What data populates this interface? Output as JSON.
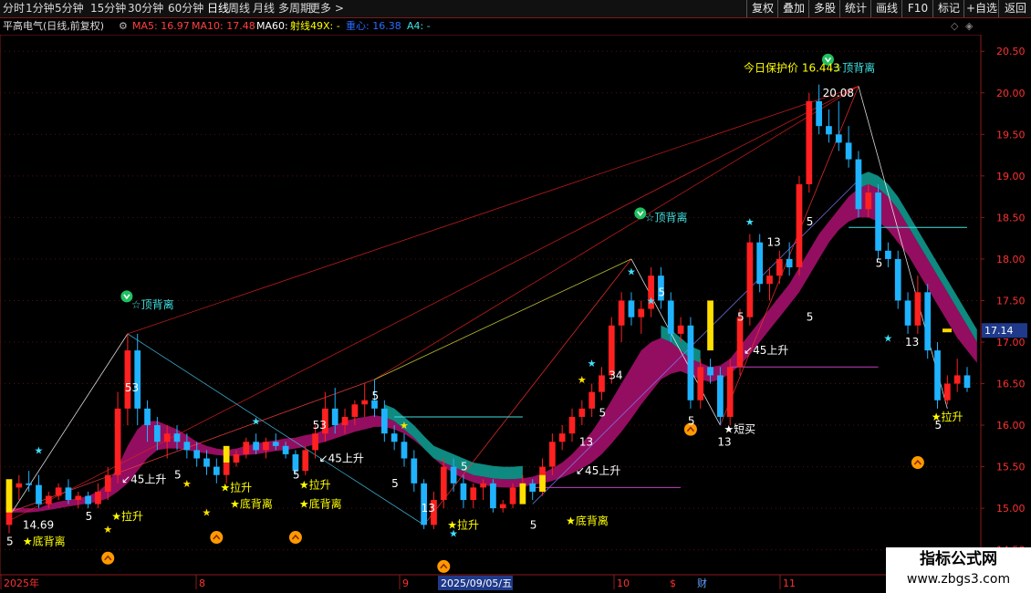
{
  "topbar": {
    "left_tabs": [
      "分时",
      "1分钟",
      "5分钟",
      "15分钟",
      "30分钟",
      "60分钟",
      "日线",
      "周线",
      "月线",
      "多周期",
      "更多 >"
    ],
    "active_tab": "日线",
    "right_buttons": [
      "复权",
      "叠加",
      "多股",
      "统计",
      "画线",
      "F10",
      "标记",
      "+自选",
      "返回"
    ]
  },
  "infobar": {
    "stock": "平高电气(日线,前复权)",
    "ma5": "MA5: 16.97",
    "ma10": "MA10: 17.48",
    "ma60": "MA60: ",
    "shexian": "射线49X: -",
    "zhongxin": "重心: 16.38",
    "a4": "A4: -",
    "colors": {
      "stock": "#cccccc",
      "ma5": "#ff4040",
      "ma10": "#ff4040",
      "ma60": "#ffffff",
      "shexian": "#ffff00",
      "zhongxin": "#2a6bff",
      "a4": "#40e0e0"
    }
  },
  "axis": {
    "y_ticks": [
      "20.50",
      "20.00",
      "19.50",
      "19.00",
      "18.50",
      "18.00",
      "17.50",
      "17.00",
      "16.50",
      "16.00",
      "15.50",
      "15.00",
      "14.50"
    ],
    "current_price": "17.14",
    "x_labels": [
      "2025年",
      "8",
      "9",
      "2025/09/05/五",
      "10",
      "11"
    ],
    "bottom_markers": [
      "$",
      "财"
    ]
  },
  "chart_data": {
    "type": "candlestick",
    "ylim": [
      14.2,
      20.7
    ],
    "candles": [
      {
        "o": 14.8,
        "h": 15.3,
        "l": 14.7,
        "c": 15.25
      },
      {
        "o": 15.25,
        "h": 15.4,
        "l": 15.1,
        "c": 15.3
      },
      {
        "o": 15.3,
        "h": 15.45,
        "l": 15.2,
        "c": 15.28
      },
      {
        "o": 15.28,
        "h": 15.4,
        "l": 15.0,
        "c": 15.05
      },
      {
        "o": 15.05,
        "h": 15.2,
        "l": 15.0,
        "c": 15.15
      },
      {
        "o": 15.15,
        "h": 15.3,
        "l": 15.1,
        "c": 15.25
      },
      {
        "o": 15.25,
        "h": 15.35,
        "l": 15.05,
        "c": 15.1
      },
      {
        "o": 15.1,
        "h": 15.2,
        "l": 15.0,
        "c": 15.15
      },
      {
        "o": 15.15,
        "h": 15.2,
        "l": 15.0,
        "c": 15.05
      },
      {
        "o": 15.05,
        "h": 15.3,
        "l": 15.0,
        "c": 15.2
      },
      {
        "o": 15.2,
        "h": 15.5,
        "l": 15.1,
        "c": 15.4
      },
      {
        "o": 15.4,
        "h": 16.4,
        "l": 15.3,
        "c": 16.2
      },
      {
        "o": 16.2,
        "h": 17.1,
        "l": 16.0,
        "c": 16.9
      },
      {
        "o": 16.9,
        "h": 17.1,
        "l": 16.0,
        "c": 16.2
      },
      {
        "o": 16.2,
        "h": 16.3,
        "l": 15.8,
        "c": 16.0
      },
      {
        "o": 16.0,
        "h": 16.1,
        "l": 15.7,
        "c": 15.8
      },
      {
        "o": 15.8,
        "h": 16.0,
        "l": 15.6,
        "c": 15.9
      },
      {
        "o": 15.9,
        "h": 16.0,
        "l": 15.7,
        "c": 15.8
      },
      {
        "o": 15.8,
        "h": 15.9,
        "l": 15.6,
        "c": 15.7
      },
      {
        "o": 15.7,
        "h": 15.8,
        "l": 15.5,
        "c": 15.6
      },
      {
        "o": 15.6,
        "h": 15.7,
        "l": 15.4,
        "c": 15.5
      },
      {
        "o": 15.5,
        "h": 15.6,
        "l": 15.3,
        "c": 15.4
      },
      {
        "o": 15.4,
        "h": 15.6,
        "l": 15.3,
        "c": 15.55
      },
      {
        "o": 15.55,
        "h": 15.7,
        "l": 15.5,
        "c": 15.65
      },
      {
        "o": 15.65,
        "h": 15.85,
        "l": 15.6,
        "c": 15.8
      },
      {
        "o": 15.8,
        "h": 15.9,
        "l": 15.65,
        "c": 15.7
      },
      {
        "o": 15.7,
        "h": 15.85,
        "l": 15.6,
        "c": 15.8
      },
      {
        "o": 15.8,
        "h": 15.9,
        "l": 15.7,
        "c": 15.75
      },
      {
        "o": 15.75,
        "h": 15.8,
        "l": 15.6,
        "c": 15.65
      },
      {
        "o": 15.65,
        "h": 15.7,
        "l": 15.4,
        "c": 15.45
      },
      {
        "o": 15.45,
        "h": 15.75,
        "l": 15.4,
        "c": 15.7
      },
      {
        "o": 15.7,
        "h": 16.0,
        "l": 15.6,
        "c": 15.9
      },
      {
        "o": 15.9,
        "h": 16.4,
        "l": 15.8,
        "c": 16.2
      },
      {
        "o": 16.2,
        "h": 16.45,
        "l": 15.9,
        "c": 16.0
      },
      {
        "o": 16.0,
        "h": 16.2,
        "l": 15.9,
        "c": 16.1
      },
      {
        "o": 16.1,
        "h": 16.3,
        "l": 16.0,
        "c": 16.25
      },
      {
        "o": 16.25,
        "h": 16.5,
        "l": 16.1,
        "c": 16.3
      },
      {
        "o": 16.3,
        "h": 16.55,
        "l": 16.1,
        "c": 16.2
      },
      {
        "o": 16.2,
        "h": 16.3,
        "l": 15.8,
        "c": 15.9
      },
      {
        "o": 15.9,
        "h": 16.0,
        "l": 15.7,
        "c": 15.8
      },
      {
        "o": 15.8,
        "h": 15.9,
        "l": 15.5,
        "c": 15.6
      },
      {
        "o": 15.6,
        "h": 15.7,
        "l": 15.2,
        "c": 15.3
      },
      {
        "o": 15.3,
        "h": 15.35,
        "l": 14.75,
        "c": 14.8
      },
      {
        "o": 14.8,
        "h": 15.2,
        "l": 14.75,
        "c": 15.1
      },
      {
        "o": 15.1,
        "h": 15.6,
        "l": 15.0,
        "c": 15.5
      },
      {
        "o": 15.5,
        "h": 15.6,
        "l": 15.2,
        "c": 15.3
      },
      {
        "o": 15.3,
        "h": 15.4,
        "l": 15.0,
        "c": 15.1
      },
      {
        "o": 15.1,
        "h": 15.3,
        "l": 15.0,
        "c": 15.25
      },
      {
        "o": 15.25,
        "h": 15.35,
        "l": 15.1,
        "c": 15.3
      },
      {
        "o": 15.3,
        "h": 15.35,
        "l": 14.95,
        "c": 15.0
      },
      {
        "o": 15.0,
        "h": 15.1,
        "l": 14.95,
        "c": 15.05
      },
      {
        "o": 15.05,
        "h": 15.3,
        "l": 15.0,
        "c": 15.25
      },
      {
        "o": 15.25,
        "h": 15.4,
        "l": 15.2,
        "c": 15.3
      },
      {
        "o": 15.3,
        "h": 15.35,
        "l": 15.1,
        "c": 15.2
      },
      {
        "o": 15.2,
        "h": 15.6,
        "l": 15.15,
        "c": 15.5
      },
      {
        "o": 15.5,
        "h": 15.9,
        "l": 15.4,
        "c": 15.8
      },
      {
        "o": 15.8,
        "h": 16.0,
        "l": 15.7,
        "c": 15.9
      },
      {
        "o": 15.9,
        "h": 16.2,
        "l": 15.8,
        "c": 16.1
      },
      {
        "o": 16.1,
        "h": 16.3,
        "l": 16.0,
        "c": 16.2
      },
      {
        "o": 16.2,
        "h": 16.5,
        "l": 16.1,
        "c": 16.4
      },
      {
        "o": 16.4,
        "h": 16.7,
        "l": 16.3,
        "c": 16.6
      },
      {
        "o": 16.6,
        "h": 17.3,
        "l": 16.5,
        "c": 17.2
      },
      {
        "o": 17.2,
        "h": 17.6,
        "l": 17.0,
        "c": 17.5
      },
      {
        "o": 17.5,
        "h": 17.6,
        "l": 17.2,
        "c": 17.3
      },
      {
        "o": 17.3,
        "h": 17.5,
        "l": 17.1,
        "c": 17.4
      },
      {
        "o": 17.4,
        "h": 17.9,
        "l": 17.3,
        "c": 17.8
      },
      {
        "o": 17.8,
        "h": 17.9,
        "l": 17.4,
        "c": 17.5
      },
      {
        "o": 17.5,
        "h": 17.6,
        "l": 17.0,
        "c": 17.1
      },
      {
        "o": 17.1,
        "h": 17.3,
        "l": 17.0,
        "c": 17.2
      },
      {
        "o": 17.2,
        "h": 17.3,
        "l": 16.2,
        "c": 16.3
      },
      {
        "o": 16.3,
        "h": 16.8,
        "l": 16.2,
        "c": 16.7
      },
      {
        "o": 16.7,
        "h": 16.8,
        "l": 16.5,
        "c": 16.6
      },
      {
        "o": 16.6,
        "h": 16.7,
        "l": 16.0,
        "c": 16.1
      },
      {
        "o": 16.1,
        "h": 16.8,
        "l": 16.0,
        "c": 16.7
      },
      {
        "o": 16.7,
        "h": 17.4,
        "l": 16.6,
        "c": 17.3
      },
      {
        "o": 17.3,
        "h": 18.3,
        "l": 17.2,
        "c": 18.2
      },
      {
        "o": 18.2,
        "h": 18.3,
        "l": 17.6,
        "c": 17.7
      },
      {
        "o": 17.7,
        "h": 17.9,
        "l": 17.5,
        "c": 17.8
      },
      {
        "o": 17.8,
        "h": 18.1,
        "l": 17.7,
        "c": 18.0
      },
      {
        "o": 18.0,
        "h": 18.2,
        "l": 17.8,
        "c": 17.9
      },
      {
        "o": 17.9,
        "h": 19.0,
        "l": 17.8,
        "c": 18.9
      },
      {
        "o": 18.9,
        "h": 20.0,
        "l": 18.8,
        "c": 19.9
      },
      {
        "o": 19.9,
        "h": 20.1,
        "l": 19.5,
        "c": 19.6
      },
      {
        "o": 19.6,
        "h": 19.8,
        "l": 19.4,
        "c": 19.5
      },
      {
        "o": 19.5,
        "h": 19.9,
        "l": 19.3,
        "c": 19.4
      },
      {
        "o": 19.4,
        "h": 19.6,
        "l": 19.1,
        "c": 19.2
      },
      {
        "o": 19.2,
        "h": 19.3,
        "l": 18.5,
        "c": 18.6
      },
      {
        "o": 18.6,
        "h": 18.9,
        "l": 18.5,
        "c": 18.8
      },
      {
        "o": 18.8,
        "h": 18.9,
        "l": 18.0,
        "c": 18.1
      },
      {
        "o": 18.1,
        "h": 18.2,
        "l": 17.9,
        "c": 18.0
      },
      {
        "o": 18.0,
        "h": 18.1,
        "l": 17.4,
        "c": 17.5
      },
      {
        "o": 17.5,
        "h": 17.6,
        "l": 17.1,
        "c": 17.2
      },
      {
        "o": 17.2,
        "h": 17.8,
        "l": 17.1,
        "c": 17.6
      },
      {
        "o": 17.6,
        "h": 17.7,
        "l": 16.8,
        "c": 16.9
      },
      {
        "o": 16.9,
        "h": 17.0,
        "l": 16.2,
        "c": 16.3
      },
      {
        "o": 16.3,
        "h": 16.6,
        "l": 16.25,
        "c": 16.5
      },
      {
        "o": 16.5,
        "h": 16.8,
        "l": 16.4,
        "c": 16.6
      },
      {
        "o": 16.6,
        "h": 16.7,
        "l": 16.4,
        "c": 16.45
      }
    ],
    "ribbon_upper": [
      15.0,
      15.0,
      15.0,
      15.0,
      15.05,
      15.08,
      15.1,
      15.12,
      15.15,
      15.2,
      15.3,
      15.5,
      15.75,
      15.95,
      16.05,
      16.05,
      16.0,
      15.95,
      15.88,
      15.8,
      15.75,
      15.72,
      15.7,
      15.72,
      15.75,
      15.78,
      15.8,
      15.82,
      15.84,
      15.85,
      15.88,
      15.9,
      15.95,
      16.0,
      16.05,
      16.08,
      16.1,
      16.12,
      16.1,
      16.05,
      15.95,
      15.85,
      15.72,
      15.6,
      15.55,
      15.5,
      15.45,
      15.4,
      15.38,
      15.36,
      15.35,
      15.35,
      15.36,
      15.38,
      15.42,
      15.48,
      15.55,
      15.65,
      15.78,
      15.92,
      16.1,
      16.3,
      16.5,
      16.7,
      16.9,
      17.0,
      17.05,
      17.0,
      16.9,
      16.8,
      16.75,
      16.7,
      16.72,
      16.8,
      16.95,
      17.1,
      17.25,
      17.4,
      17.55,
      17.7,
      17.9,
      18.1,
      18.3,
      18.45,
      18.6,
      18.75,
      18.85,
      18.9,
      18.85,
      18.75,
      18.6,
      18.4,
      18.2,
      18.0,
      17.8,
      17.6,
      17.4,
      17.2,
      17.0
    ],
    "ribbon_lower": [
      14.95,
      14.95,
      14.95,
      14.96,
      14.98,
      15.0,
      15.02,
      15.04,
      15.06,
      15.08,
      15.12,
      15.2,
      15.3,
      15.45,
      15.6,
      15.7,
      15.72,
      15.72,
      15.7,
      15.68,
      15.66,
      15.64,
      15.63,
      15.63,
      15.64,
      15.65,
      15.67,
      15.69,
      15.7,
      15.72,
      15.74,
      15.77,
      15.8,
      15.84,
      15.88,
      15.92,
      15.95,
      15.98,
      15.98,
      15.95,
      15.9,
      15.82,
      15.72,
      15.6,
      15.5,
      15.42,
      15.36,
      15.31,
      15.28,
      15.26,
      15.25,
      15.25,
      15.26,
      15.28,
      15.3,
      15.33,
      15.37,
      15.42,
      15.48,
      15.55,
      15.65,
      15.78,
      15.92,
      16.08,
      16.25,
      16.4,
      16.55,
      16.62,
      16.65,
      16.6,
      16.55,
      16.52,
      16.55,
      16.62,
      16.72,
      16.85,
      17.0,
      17.15,
      17.3,
      17.45,
      17.6,
      17.8,
      18.0,
      18.2,
      18.35,
      18.45,
      18.5,
      18.5,
      18.45,
      18.35,
      18.2,
      18.05,
      17.85,
      17.65,
      17.45,
      17.25,
      17.05,
      16.9,
      16.75
    ],
    "annotations": [
      {
        "text": "☆顶背离",
        "i": 12,
        "p": 17.45,
        "color": "#40e0e0"
      },
      {
        "text": "☆顶背离",
        "i": 64,
        "p": 18.5,
        "color": "#40e0e0"
      },
      {
        "text": "☆顶背离",
        "i": 83,
        "p": 20.3,
        "color": "#40e0e0"
      },
      {
        "text": "今日保护价 16.443",
        "i": 74,
        "p": 20.3,
        "color": "#ffff00"
      },
      {
        "text": "20.08",
        "i": 82,
        "p": 20.0,
        "color": "#ffffff"
      },
      {
        "text": "14.69",
        "i": 1,
        "p": 14.8,
        "color": "#ffffff"
      },
      {
        "text": "★底背离",
        "i": 1,
        "p": 14.6,
        "color": "#ffff00"
      },
      {
        "text": "★底背离",
        "i": 22,
        "p": 15.05,
        "color": "#ffff00"
      },
      {
        "text": "★底背离",
        "i": 29,
        "p": 15.05,
        "color": "#ffff00"
      },
      {
        "text": "★底背离",
        "i": 56,
        "p": 14.85,
        "color": "#ffff00"
      },
      {
        "text": "★拉升",
        "i": 10,
        "p": 14.9,
        "color": "#ffff00"
      },
      {
        "text": "★拉升",
        "i": 21,
        "p": 15.25,
        "color": "#ffff00"
      },
      {
        "text": "★拉升",
        "i": 29,
        "p": 15.28,
        "color": "#ffff00"
      },
      {
        "text": "★拉升",
        "i": 44,
        "p": 14.8,
        "color": "#ffff00"
      },
      {
        "text": "★拉升",
        "i": 93,
        "p": 16.1,
        "color": "#ffff00"
      },
      {
        "text": "↙45上升",
        "i": 11,
        "p": 15.35,
        "color": "#ffffff"
      },
      {
        "text": "↙45上升",
        "i": 31,
        "p": 15.6,
        "color": "#ffffff"
      },
      {
        "text": "↙45上升",
        "i": 57,
        "p": 15.45,
        "color": "#ffffff"
      },
      {
        "text": "↙45上升",
        "i": 74,
        "p": 16.9,
        "color": "#ffffff"
      },
      {
        "text": "★短买",
        "i": 72,
        "p": 15.95,
        "color": "#ffffff"
      },
      {
        "text": "53",
        "i": 12,
        "p": 16.45,
        "color": "#ffffff"
      },
      {
        "text": "53",
        "i": 31,
        "p": 16.0,
        "color": "#ffffff"
      },
      {
        "text": "34",
        "i": 61,
        "p": 16.6,
        "color": "#ffffff"
      },
      {
        "text": "13",
        "i": 42,
        "p": 15.0,
        "color": "#ffffff"
      },
      {
        "text": "13",
        "i": 58,
        "p": 15.8,
        "color": "#ffffff"
      },
      {
        "text": "13",
        "i": 72,
        "p": 15.8,
        "color": "#ffffff"
      },
      {
        "text": "13",
        "i": 77,
        "p": 18.2,
        "color": "#ffffff"
      },
      {
        "text": "13",
        "i": 91,
        "p": 17.0,
        "color": "#ffffff"
      },
      {
        "text": "5",
        "i": 0,
        "p": 14.6,
        "color": "#ffffff"
      },
      {
        "text": "5",
        "i": 8,
        "p": 14.9,
        "color": "#ffffff"
      },
      {
        "text": "5",
        "i": 17,
        "p": 15.4,
        "color": "#ffffff"
      },
      {
        "text": "5",
        "i": 29,
        "p": 15.4,
        "color": "#ffffff"
      },
      {
        "text": "5",
        "i": 37,
        "p": 16.35,
        "color": "#ffffff"
      },
      {
        "text": "5",
        "i": 39,
        "p": 15.3,
        "color": "#ffffff"
      },
      {
        "text": "5",
        "i": 46,
        "p": 15.5,
        "color": "#ffffff"
      },
      {
        "text": "5",
        "i": 53,
        "p": 14.8,
        "color": "#ffffff"
      },
      {
        "text": "5",
        "i": 60,
        "p": 16.15,
        "color": "#ffffff"
      },
      {
        "text": "5",
        "i": 66,
        "p": 17.6,
        "color": "#ffffff"
      },
      {
        "text": "5",
        "i": 69,
        "p": 16.05,
        "color": "#ffffff"
      },
      {
        "text": "5",
        "i": 74,
        "p": 17.3,
        "color": "#ffffff"
      },
      {
        "text": "5",
        "i": 81,
        "p": 17.3,
        "color": "#ffffff"
      },
      {
        "text": "5",
        "i": 81,
        "p": 18.45,
        "color": "#ffffff"
      },
      {
        "text": "5",
        "i": 88,
        "p": 17.95,
        "color": "#ffffff"
      },
      {
        "text": "5",
        "i": 94,
        "p": 16.0,
        "color": "#ffffff"
      }
    ]
  }
}
